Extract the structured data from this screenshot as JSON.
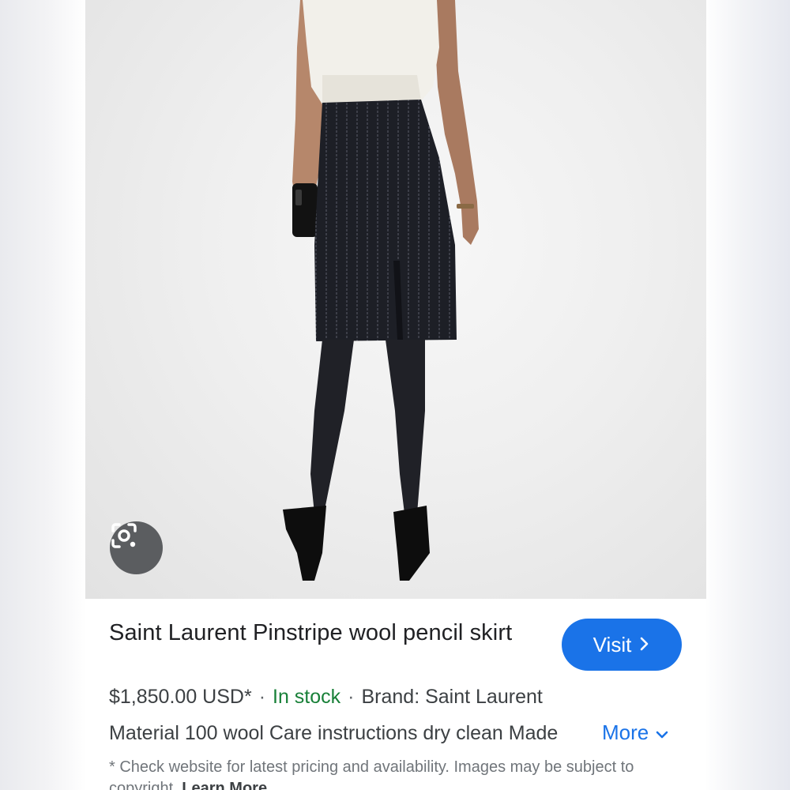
{
  "product": {
    "title": "Saint Laurent Pinstripe wool pencil skirt",
    "price": "$1,850.00 USD*",
    "separator": "·",
    "stock": "In stock",
    "brand": "Brand: Saint Laurent",
    "description": "Material 100 wool Care instructions dry clean Made",
    "more_label": "More",
    "disclaimer": "* Check website for latest pricing and availability. Images may be subject to copyright.",
    "learn_more_label": "Learn More"
  },
  "actions": {
    "visit_label": "Visit"
  },
  "icons": {
    "lens": "google-lens-icon",
    "visit_chevron": "chevron-right-icon",
    "more_chevron": "chevron-down-icon"
  },
  "colors": {
    "accent": "#1a73e8",
    "stock": "#188038",
    "text": "#202124",
    "muted": "#70757a"
  }
}
